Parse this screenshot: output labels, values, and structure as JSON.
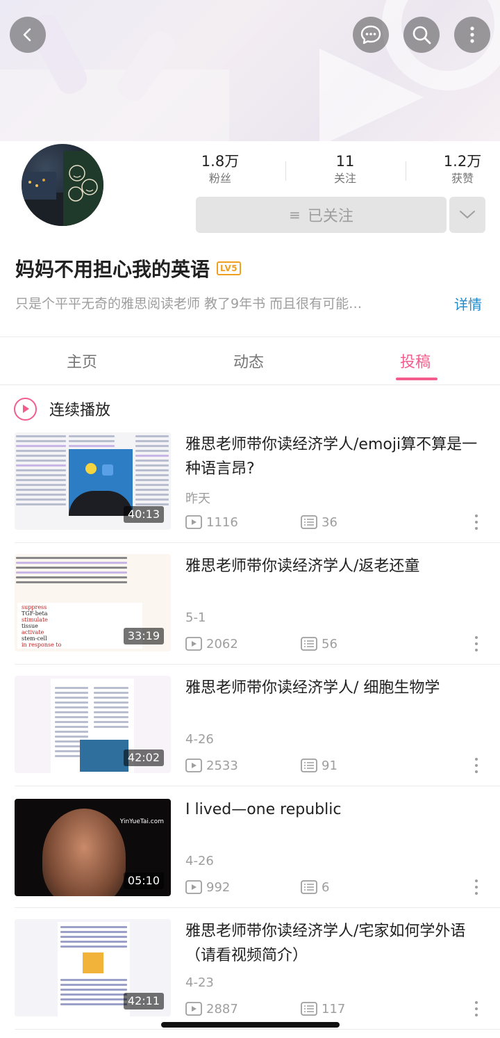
{
  "header": {
    "back_icon": "chevron-left-icon",
    "message_icon": "message-bubble-icon",
    "search_icon": "search-icon",
    "more_icon": "more-vertical-icon"
  },
  "profile": {
    "stats": [
      {
        "value": "1.8万",
        "label": "粉丝"
      },
      {
        "value": "11",
        "label": "关注"
      },
      {
        "value": "1.2万",
        "label": "获赞"
      }
    ],
    "follow_label": "已关注",
    "name": "妈妈不用担心我的英语",
    "level": "LV5",
    "bio": "只是个平平无奇的雅思阅读老师  教了9年书  而且很有可能…",
    "detail_link": "详情"
  },
  "tabs": [
    {
      "label": "主页",
      "active": false
    },
    {
      "label": "动态",
      "active": false
    },
    {
      "label": "投稿",
      "active": true
    }
  ],
  "autoplay_label": "连续播放",
  "accent_color": "#f25d8e",
  "videos": [
    {
      "title": "雅思老师带你读经济学人/emoji算不算是一种语言昂?",
      "date": "昨天",
      "duration": "40:13",
      "plays": "1116",
      "comments": "36"
    },
    {
      "title": "雅思老师带你读经济学人/返老还童",
      "date": "5-1",
      "duration": "33:19",
      "plays": "2062",
      "comments": "56"
    },
    {
      "title": "雅思老师带你读经济学人/  细胞生物学",
      "date": "4-26",
      "duration": "42:02",
      "plays": "2533",
      "comments": "91"
    },
    {
      "title": "I  lived—one  republic",
      "date": "4-26",
      "duration": "05:10",
      "plays": "992",
      "comments": "6"
    },
    {
      "title": "雅思老师带你读经济学人/宅家如何学外语（请看视频简介）",
      "date": "4-23",
      "duration": "42:11",
      "plays": "2887",
      "comments": "117"
    }
  ],
  "thumb_text": {
    "video2_words": [
      "suppress",
      "TGF-beta",
      "stimulate",
      "tissue",
      "activate",
      "stem-cell",
      "in response to"
    ],
    "video4_watermark": "YinYueTai.com"
  }
}
